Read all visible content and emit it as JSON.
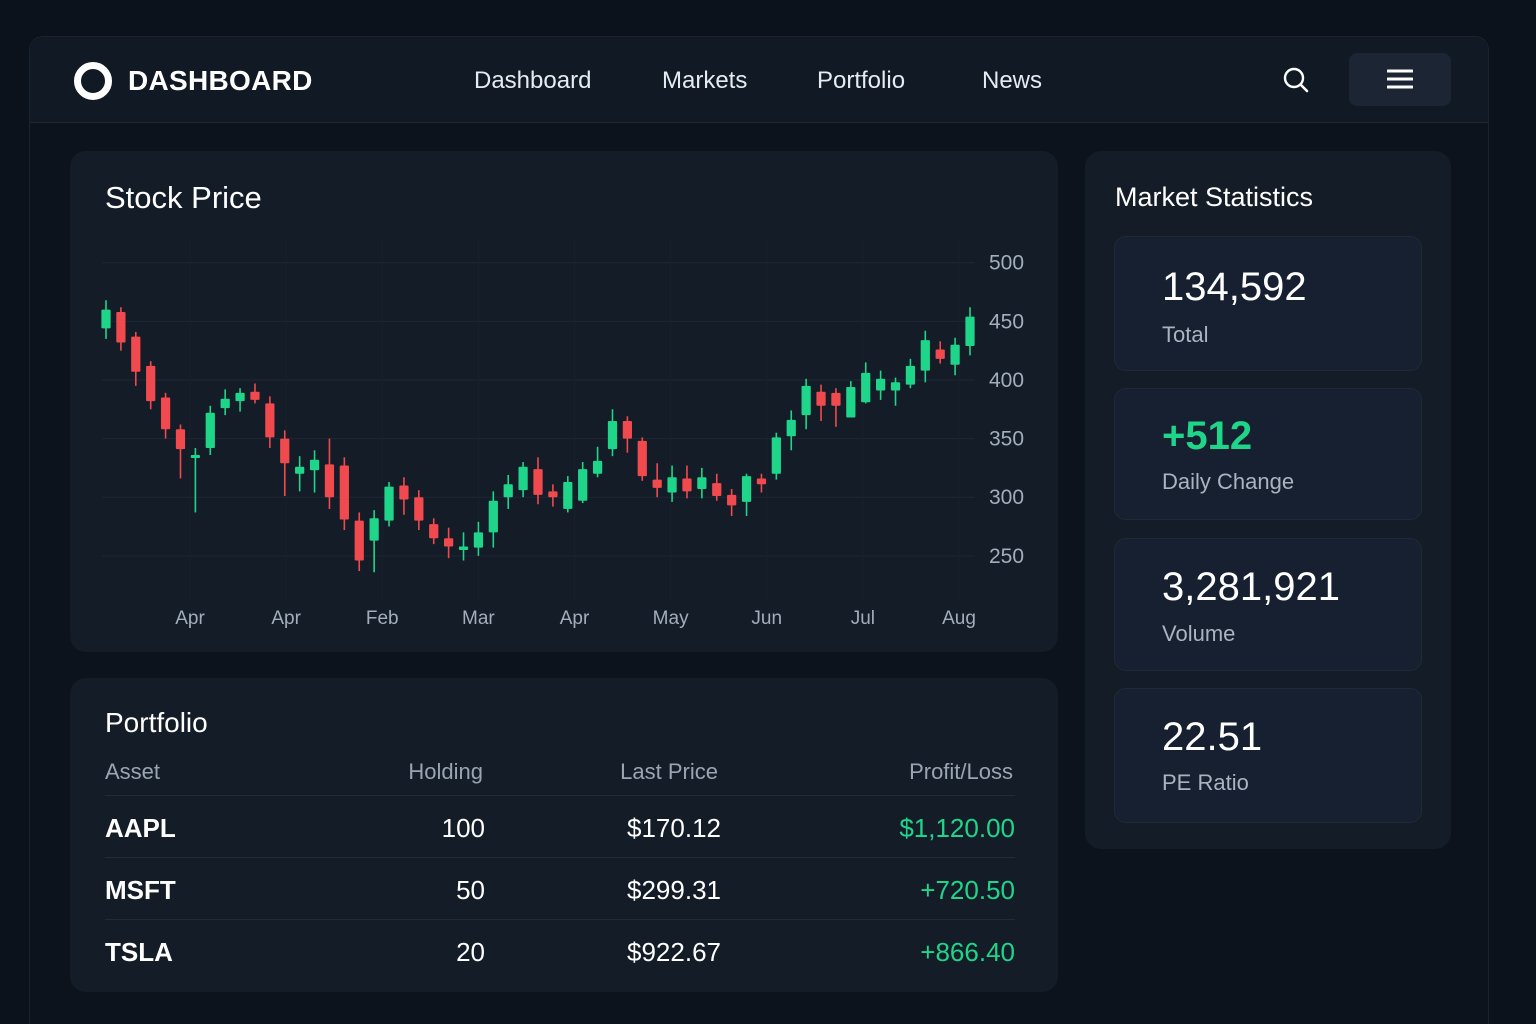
{
  "header": {
    "brand": "DASHBOARD",
    "nav": [
      "Dashboard",
      "Markets",
      "Portfolio",
      "News"
    ],
    "icons": {
      "search": "search-icon",
      "menu": "hamburger-menu-icon",
      "logo": "ring-logo-icon"
    }
  },
  "colors": {
    "up": "#1fd58a",
    "down": "#f04a4f",
    "background": "#0c121c",
    "card": "#141c28"
  },
  "stock_chart": {
    "title": "Stock Price"
  },
  "chart_data": {
    "type": "candlestick",
    "title": "Stock Price",
    "x_tick_labels": [
      "Apr",
      "Apr",
      "Feb",
      "Mar",
      "Apr",
      "May",
      "Jun",
      "Jul",
      "Aug"
    ],
    "y_ticks": [
      250,
      300,
      350,
      400,
      450,
      500
    ],
    "ylim": [
      220,
      510
    ],
    "y_axis_side": "right",
    "grid": true,
    "up_color": "#1fd58a",
    "down_color": "#f04a4f",
    "ohlc": [
      [
        444,
        460,
        468,
        435
      ],
      [
        458,
        432,
        462,
        425
      ],
      [
        437,
        407,
        441,
        395
      ],
      [
        412,
        382,
        416,
        375
      ],
      [
        385,
        358,
        389,
        350
      ],
      [
        358,
        341,
        362,
        316
      ],
      [
        336,
        336,
        342,
        287
      ],
      [
        342,
        372,
        378,
        336
      ],
      [
        376,
        384,
        392,
        370
      ],
      [
        382,
        389,
        393,
        373
      ],
      [
        390,
        383,
        397,
        380
      ],
      [
        380,
        351,
        386,
        342
      ],
      [
        350,
        329,
        357,
        301
      ],
      [
        320,
        326,
        335,
        305
      ],
      [
        323,
        332,
        340,
        304
      ],
      [
        328,
        300,
        350,
        290
      ],
      [
        327,
        281,
        334,
        272
      ],
      [
        280,
        246,
        287,
        237
      ],
      [
        263,
        282,
        289,
        236
      ],
      [
        280,
        309,
        313,
        275
      ],
      [
        310,
        298,
        317,
        285
      ],
      [
        300,
        280,
        306,
        272
      ],
      [
        277,
        265,
        282,
        260
      ],
      [
        265,
        258,
        274,
        248
      ],
      [
        255,
        258,
        270,
        246
      ],
      [
        257,
        270,
        279,
        250
      ],
      [
        270,
        297,
        305,
        257
      ],
      [
        300,
        311,
        319,
        290
      ],
      [
        306,
        326,
        330,
        300
      ],
      [
        324,
        302,
        334,
        294
      ],
      [
        305,
        300,
        311,
        292
      ],
      [
        290,
        313,
        318,
        287
      ],
      [
        297,
        324,
        330,
        295
      ],
      [
        320,
        331,
        343,
        317
      ],
      [
        341,
        365,
        375,
        335
      ],
      [
        365,
        350,
        369,
        338
      ],
      [
        348,
        318,
        351,
        314
      ],
      [
        315,
        308,
        329,
        300
      ],
      [
        304,
        317,
        327,
        296
      ],
      [
        316,
        305,
        327,
        299
      ],
      [
        307,
        317,
        325,
        299
      ],
      [
        312,
        301,
        320,
        297
      ],
      [
        302,
        293,
        307,
        284
      ],
      [
        296,
        318,
        320,
        284
      ],
      [
        316,
        311,
        320,
        304
      ],
      [
        320,
        351,
        355,
        315
      ],
      [
        352,
        366,
        374,
        340
      ],
      [
        370,
        395,
        401,
        358
      ],
      [
        390,
        378,
        396,
        365
      ],
      [
        389,
        378,
        393,
        360
      ],
      [
        368,
        394,
        399,
        370
      ],
      [
        381,
        406,
        415,
        380
      ],
      [
        391,
        401,
        408,
        383
      ],
      [
        391,
        398,
        402,
        378
      ],
      [
        396,
        412,
        418,
        393
      ],
      [
        408,
        434,
        442,
        398
      ],
      [
        426,
        418,
        433,
        414
      ],
      [
        413,
        430,
        436,
        404
      ],
      [
        429,
        454,
        462,
        421
      ]
    ]
  },
  "portfolio": {
    "title": "Portfolio",
    "columns": [
      "Asset",
      "Holding",
      "Last Price",
      "Profit/Loss"
    ],
    "rows": [
      {
        "asset": "AAPL",
        "holding": "100",
        "price": "$170.12",
        "pl": "$1,120.00"
      },
      {
        "asset": "MSFT",
        "holding": "50",
        "price": "$299.31",
        "pl": "+720.50"
      },
      {
        "asset": "TSLA",
        "holding": "20",
        "price": "$922.67",
        "pl": "+866.40"
      }
    ]
  },
  "stats": {
    "title": "Market Statistics",
    "items": [
      {
        "value": "134,592",
        "label": "Total"
      },
      {
        "value": "+512",
        "label": "Daily Change"
      },
      {
        "value": "3,281,921",
        "label": "Volume"
      },
      {
        "value": "22.51",
        "label": "PE Ratio"
      }
    ]
  }
}
